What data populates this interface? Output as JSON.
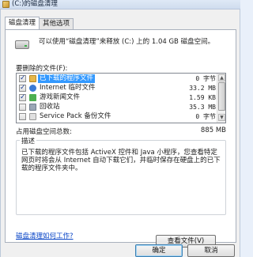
{
  "window": {
    "title": "(C:)的磁盘清理"
  },
  "tabs": [
    {
      "label": "磁盘清理",
      "active": true
    },
    {
      "label": "其他选项",
      "active": false
    }
  ],
  "intro_text": "可以使用“磁盘清理”来释放 (C:) 上的 1.04 GB 磁盘空间。",
  "files_label": "要删除的文件(F):",
  "files": [
    {
      "name": "已下载的程序文件",
      "size": "0 字节",
      "checked": true,
      "selected": true,
      "icon": "folder-icon",
      "icon_color": "#e6b74a"
    },
    {
      "name": "Internet 临时文件",
      "size": "33.2 MB",
      "checked": true,
      "selected": false,
      "icon": "internet-icon",
      "icon_color": "#3a7bd5"
    },
    {
      "name": "游戏新闻文件",
      "size": "1.59 KB",
      "checked": true,
      "selected": false,
      "icon": "game-icon",
      "icon_color": "#4caf50"
    },
    {
      "name": "回收站",
      "size": "35.3 MB",
      "checked": false,
      "selected": false,
      "icon": "recycle-bin-icon",
      "icon_color": "#9aa7b6"
    },
    {
      "name": "Service Pack 备份文件",
      "size": "0 字节",
      "checked": false,
      "selected": false,
      "icon": "file-icon",
      "icon_color": "#e0e0e0"
    }
  ],
  "space_label": "占用磁盘空间总数:",
  "space_value": "885 MB",
  "description": {
    "title": "描述",
    "text": "已下载的程序文件包括 ActiveX 控件和 Java 小程序，您查看特定网页时将会从 Internet 自动下载它们，并临时保存在硬盘上的已下载的程序文件夹中。",
    "view_button": "查看文件(V)"
  },
  "help_link": "磁盘清理如何工作?",
  "buttons": {
    "ok": "确定",
    "cancel": "取消"
  }
}
